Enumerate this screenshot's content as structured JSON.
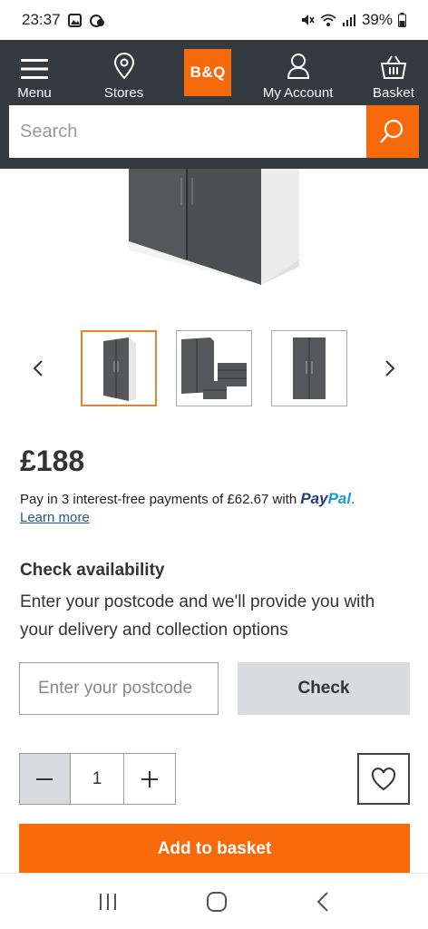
{
  "status_bar": {
    "time": "23:37",
    "battery": "39%"
  },
  "header": {
    "menu_label": "Menu",
    "stores_label": "Stores",
    "logo_text": "B&Q",
    "account_label": "My Account",
    "basket_label": "Basket",
    "search_placeholder": "Search"
  },
  "colors": {
    "header_bg": "#333b41",
    "brand_orange": "#f76a0c",
    "check_button_bg": "#d9dbde"
  },
  "gallery": {
    "prev_icon": "chevron-left-icon",
    "next_icon": "chevron-right-icon",
    "selected_index": 0
  },
  "product": {
    "price": "£188",
    "paypal_text": "Pay in 3 interest-free payments of £62.67 with",
    "paypal_brand_1": "Pay",
    "paypal_brand_2": "Pal",
    "paypal_suffix": ".",
    "learn_more": "Learn more"
  },
  "availability": {
    "title": "Check availability",
    "description": "Enter your postcode and we'll provide you with your delivery and collection options",
    "postcode_placeholder": "Enter your postcode",
    "check_label": "Check"
  },
  "quantity": {
    "value": "1"
  },
  "actions": {
    "add_to_basket": "Add to basket"
  }
}
